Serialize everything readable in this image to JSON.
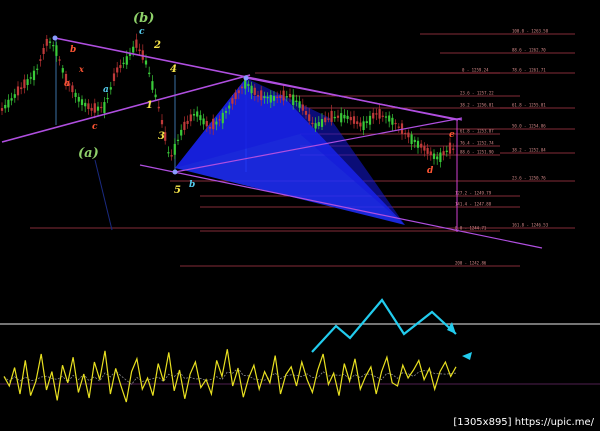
{
  "chart_data": {
    "type": "line",
    "title": "",
    "xlabel": "",
    "ylabel": "",
    "price_panel": {
      "fib_levels": [
        {
          "label": "100.0 - 1263.58"
        },
        {
          "label": "88.6 - 1262.70"
        },
        {
          "label": "78.6 - 1261.71"
        },
        {
          "label": "0 - 1259.24"
        },
        {
          "label": "23.6 - 1257.22"
        },
        {
          "label": "38.2 - 1256.01"
        },
        {
          "label": "61.8 - 1255.01"
        },
        {
          "label": "50.0 - 1254.86"
        },
        {
          "label": "61.8 - 1253.87"
        },
        {
          "label": "76.4 - 1252.74"
        },
        {
          "label": "88.6 - 1251.90"
        },
        {
          "label": "38.2 - 1252.84"
        },
        {
          "label": "23.6 - 1250.76"
        },
        {
          "label": "127.2 - 1249.79"
        },
        {
          "label": "141.4 - 1247.88"
        },
        {
          "label": "161.8 - 1246.53"
        },
        {
          "label": "0.0 - 1244.71"
        },
        {
          "label": "200 - 1242.86"
        }
      ],
      "wave_labels": [
        {
          "text": "(b)",
          "color": "#8fd16a"
        },
        {
          "text": "(a)",
          "color": "#8fd16a"
        },
        {
          "text": "c",
          "color": "#55ccee"
        },
        {
          "text": "2",
          "color": "#f5e44a"
        },
        {
          "text": "4",
          "color": "#f5e44a"
        },
        {
          "text": "1",
          "color": "#f5e44a"
        },
        {
          "text": "3",
          "color": "#f5e44a"
        },
        {
          "text": "5",
          "color": "#f5e44a"
        },
        {
          "text": "b",
          "color": "#55ccee"
        },
        {
          "text": "a",
          "color": "#55ccee"
        },
        {
          "text": "b",
          "color": "#ff5533"
        },
        {
          "text": "x",
          "color": "#ff5533"
        },
        {
          "text": "a",
          "color": "#ff5533"
        },
        {
          "text": "c",
          "color": "#ff5533"
        },
        {
          "text": "d",
          "color": "#ff5533"
        },
        {
          "text": "e",
          "color": "#ff5533"
        }
      ],
      "colors": {
        "channel": "#b04fe0",
        "pattern_fill": "#1f2fff",
        "candles": "#3acb3a",
        "fib_lines": "#b03a4a",
        "oscillator": "#e8e020",
        "arrows": "#22ccee"
      }
    },
    "oscillator_panel": {
      "series": [
        {
          "values": [
            0.52,
            0.4,
            0.63,
            0.3,
            0.72,
            0.28,
            0.46,
            0.8,
            0.35,
            0.58,
            0.22,
            0.66,
            0.44,
            0.76,
            0.32,
            0.55,
            0.25,
            0.7,
            0.48,
            0.84,
            0.3,
            0.62,
            0.4,
            0.2,
            0.58,
            0.74,
            0.36,
            0.5,
            0.28,
            0.68,
            0.46,
            0.82,
            0.34,
            0.6,
            0.24,
            0.55,
            0.7,
            0.38,
            0.48,
            0.3,
            0.72,
            0.52,
            0.86,
            0.4,
            0.62,
            0.26,
            0.5,
            0.66,
            0.36,
            0.58,
            0.44,
            0.78,
            0.3,
            0.54,
            0.64,
            0.4,
            0.7,
            0.48,
            0.32,
            0.6,
            0.8,
            0.42,
            0.56,
            0.28,
            0.68,
            0.46,
            0.74,
            0.36,
            0.52,
            0.64,
            0.3,
            0.58,
            0.76,
            0.44,
            0.4,
            0.66,
            0.5,
            0.6,
            0.72,
            0.48,
            0.62,
            0.36,
            0.58,
            0.7,
            0.52,
            0.64
          ]
        }
      ]
    }
  },
  "watermark": "[1305x895] https://upic.me/"
}
